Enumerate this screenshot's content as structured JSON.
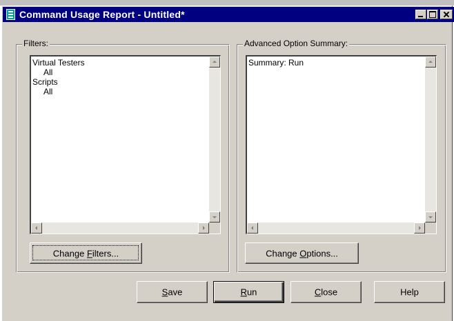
{
  "window": {
    "title": "Command Usage Report - Untitled*",
    "icon": "report-app-icon",
    "controls": [
      "minimize-icon",
      "maximize-icon",
      "close-icon"
    ]
  },
  "filters": {
    "label": "Filters:",
    "items": [
      "Virtual Testers",
      "All",
      "Scripts",
      "All"
    ],
    "button": {
      "before": "Change ",
      "accel": "F",
      "after": "ilters..."
    }
  },
  "advanced": {
    "label": "Advanced Option Summary:",
    "items": [
      "Summary: Run"
    ],
    "button": {
      "before": "Change ",
      "accel": "O",
      "after": "ptions..."
    }
  },
  "buttons": {
    "save": {
      "accel": "S",
      "after": "ave"
    },
    "run": {
      "accel": "R",
      "after": "un"
    },
    "close": {
      "accel": "C",
      "after": "lose"
    },
    "help": "Help"
  },
  "colors": {
    "titlebar": "#000080",
    "face": "#d4d0c8",
    "list_bg": "#ffffff"
  }
}
